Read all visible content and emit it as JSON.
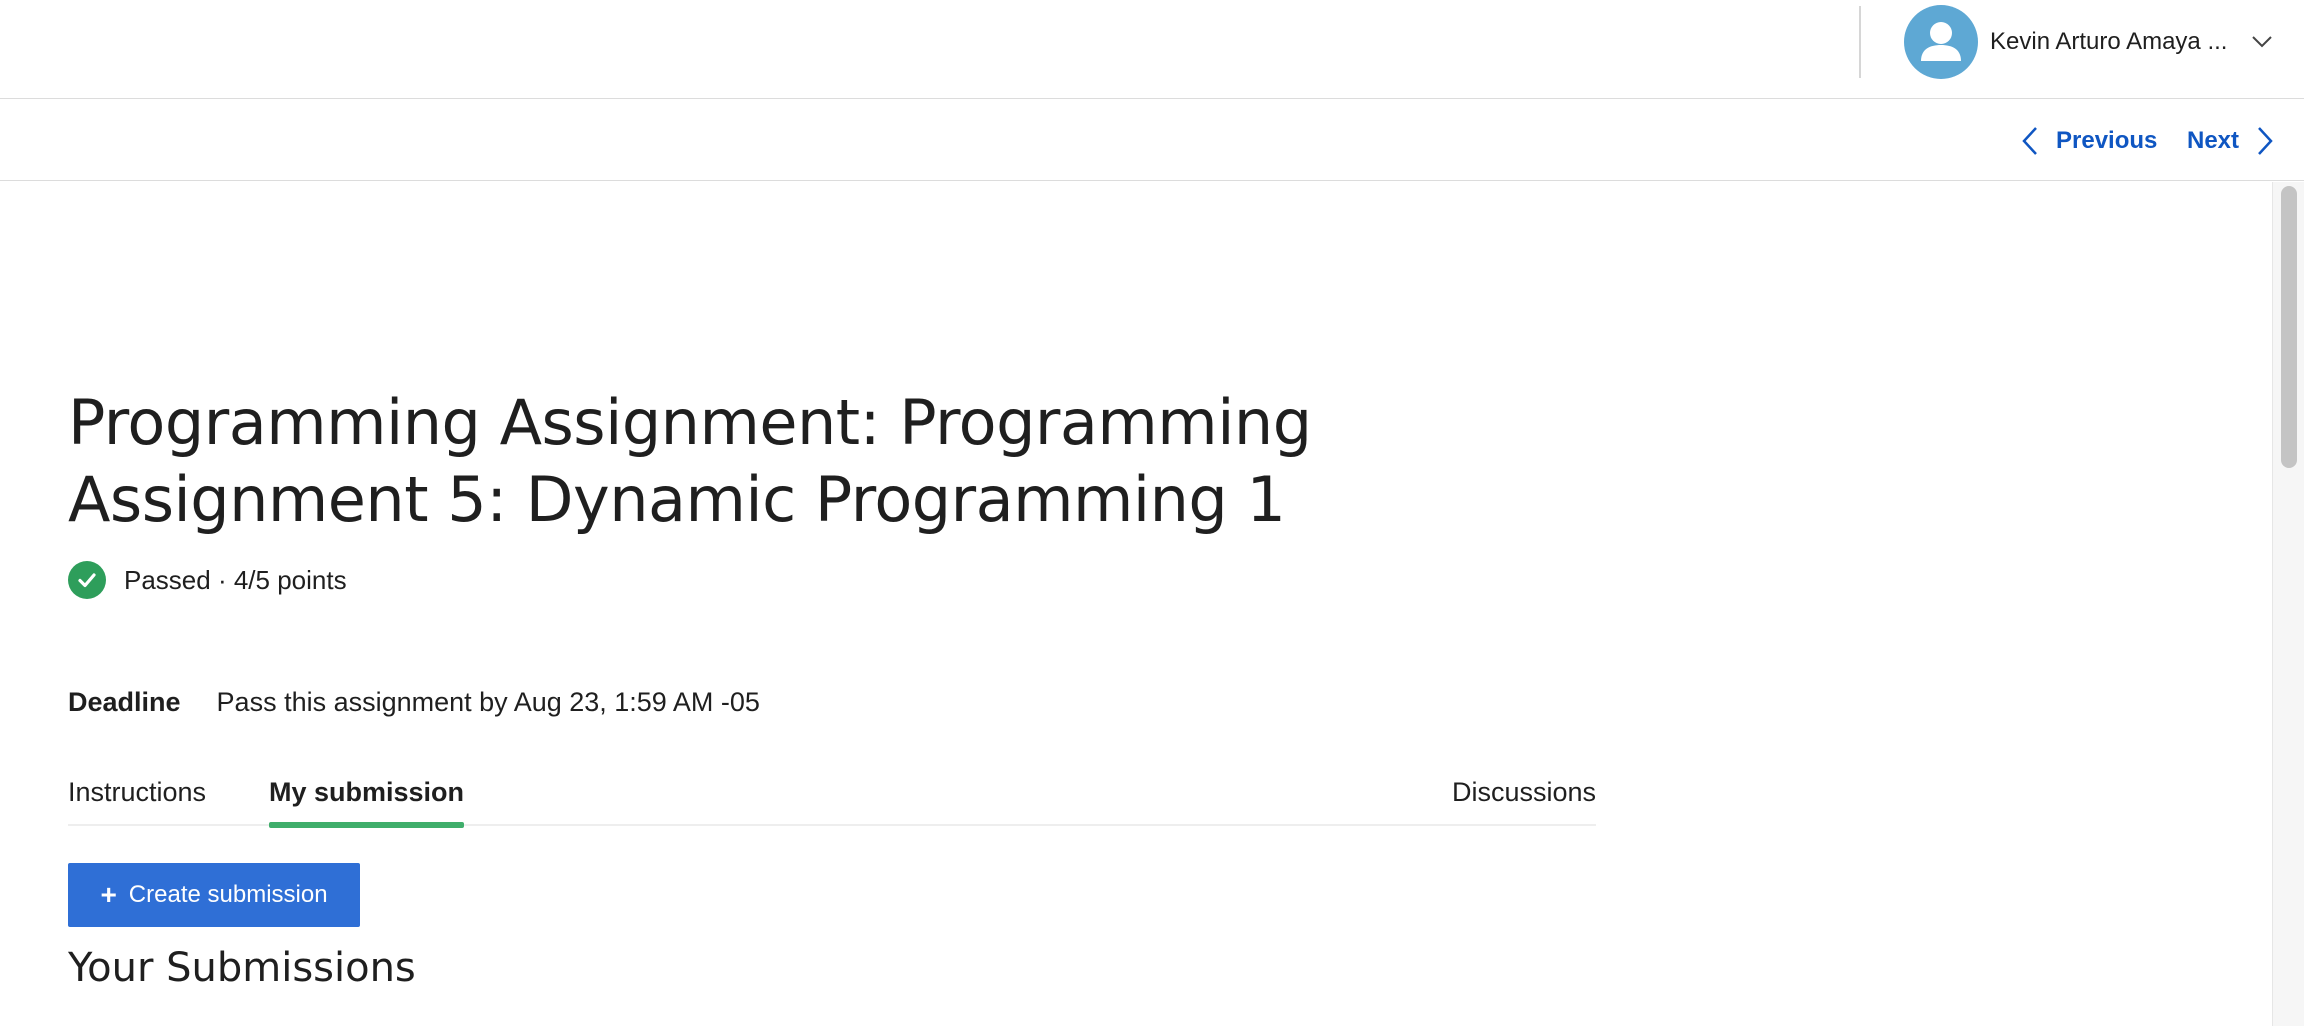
{
  "header": {
    "user_name": "Kevin Arturo Amaya ...",
    "avatar_icon": "user-silhouette-icon",
    "menu_icon": "chevron-down-icon"
  },
  "navigation": {
    "previous_label": "Previous",
    "next_label": "Next",
    "previous_icon": "chevron-left-icon",
    "next_icon": "chevron-right-icon"
  },
  "assignment": {
    "title": "Programming Assignment: Programming Assignment 5: Dynamic Programming 1",
    "status_icon": "check-circle-icon",
    "status_text": "Passed · 4/5 points",
    "deadline_label": "Deadline",
    "deadline_value": "Pass this assignment by Aug 23, 1:59 AM -05"
  },
  "tabs": [
    {
      "label": "Instructions",
      "active": false
    },
    {
      "label": "My submission",
      "active": true
    },
    {
      "label": "Discussions",
      "active": false
    }
  ],
  "actions": {
    "create_submission_label": "Create submission",
    "create_submission_icon": "plus-icon"
  },
  "submissions": {
    "heading": "Your Submissions"
  },
  "colors": {
    "link_blue": "#0f56c2",
    "button_blue": "#2f6fd6",
    "success_green": "#2e9e5b",
    "tab_underline_green": "#3fae6b",
    "avatar_blue": "#5ea8d4"
  }
}
